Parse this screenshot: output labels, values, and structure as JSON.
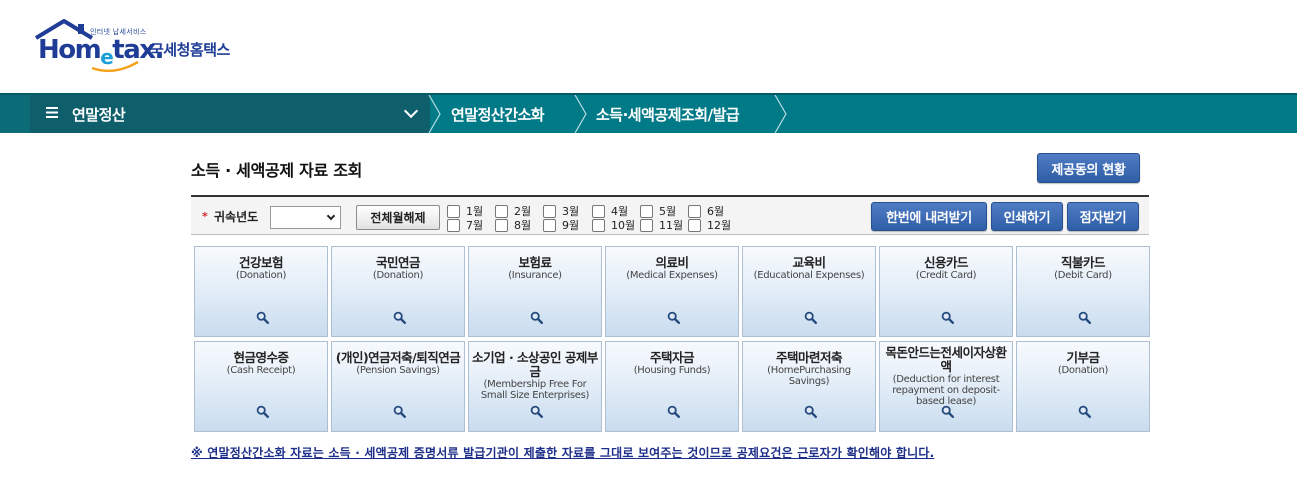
{
  "logo": {
    "subtitle": "인터넷 납세서비스",
    "brand_prefix": "Hom",
    "brand_e": "e",
    "brand_suffix": "tax.",
    "korean_name": "국세청홈택스",
    "colors": {
      "primary": "#1f3d96",
      "accent": "#1b9fd6",
      "swoosh": "#f4a21b"
    }
  },
  "nav": {
    "menu_icon": "hamburger-icon",
    "menu_label": "연말정산",
    "breadcrumbs": [
      "연말정산간소화",
      "소득·세액공제조회/발급"
    ],
    "colors": {
      "bar": "#007a87",
      "menu": "#0e5f6b"
    }
  },
  "page": {
    "title": "소득 · 세액공제 자료 조회",
    "provider_status_button": "제공동의 현황"
  },
  "filter": {
    "required_mark": "*",
    "year_label": "귀속년도",
    "year_value": "",
    "select_all_button": "전체월해제",
    "months": [
      "1월",
      "2월",
      "3월",
      "4월",
      "5월",
      "6월",
      "7월",
      "8월",
      "9월",
      "10월",
      "11월",
      "12월"
    ],
    "download_all_button": "한번에 내려받기",
    "print_button": "인쇄하기",
    "braille_button": "점자받기"
  },
  "cards": [
    {
      "title": "건강보험",
      "sub": "(Donation)",
      "icon": "search-icon"
    },
    {
      "title": "국민연금",
      "sub": "(Donation)",
      "icon": "search-icon"
    },
    {
      "title": "보험료",
      "sub": "(Insurance)",
      "icon": "search-icon"
    },
    {
      "title": "의료비",
      "sub": "(Medical Expenses)",
      "icon": "search-icon"
    },
    {
      "title": "교육비",
      "sub": "(Educational Expenses)",
      "icon": "search-icon"
    },
    {
      "title": "신용카드",
      "sub": "(Credit Card)",
      "icon": "search-icon"
    },
    {
      "title": "직불카드",
      "sub": "(Debit Card)",
      "icon": "search-icon"
    },
    {
      "title": "현금영수증",
      "sub": "(Cash Receipt)",
      "icon": "search-icon"
    },
    {
      "title": "(개인)연금저축/퇴직연금",
      "sub": "(Pension Savings)",
      "icon": "search-icon"
    },
    {
      "title": "소기업 · 소상공인 공제부금",
      "sub": "(Membership Free For Small Size Enterprises)",
      "icon": "search-icon"
    },
    {
      "title": "주택자금",
      "sub": "(Housing Funds)",
      "icon": "search-icon"
    },
    {
      "title": "주택마련저축",
      "sub": "(HomePurchasing Savings)",
      "icon": "search-icon"
    },
    {
      "title": "목돈안드는전세이자상환액",
      "sub": "(Deduction for interest repayment on deposit-based lease)",
      "icon": "search-icon"
    },
    {
      "title": "기부금",
      "sub": "(Donation)",
      "icon": "search-icon"
    }
  ],
  "notice": "※ 연말정산간소화 자료는 소득 · 세액공제 증명서류 발급기관이 제출한 자료를 그대로 보여주는 것이므로 공제요건은 근로자가 확인해야 합니다."
}
